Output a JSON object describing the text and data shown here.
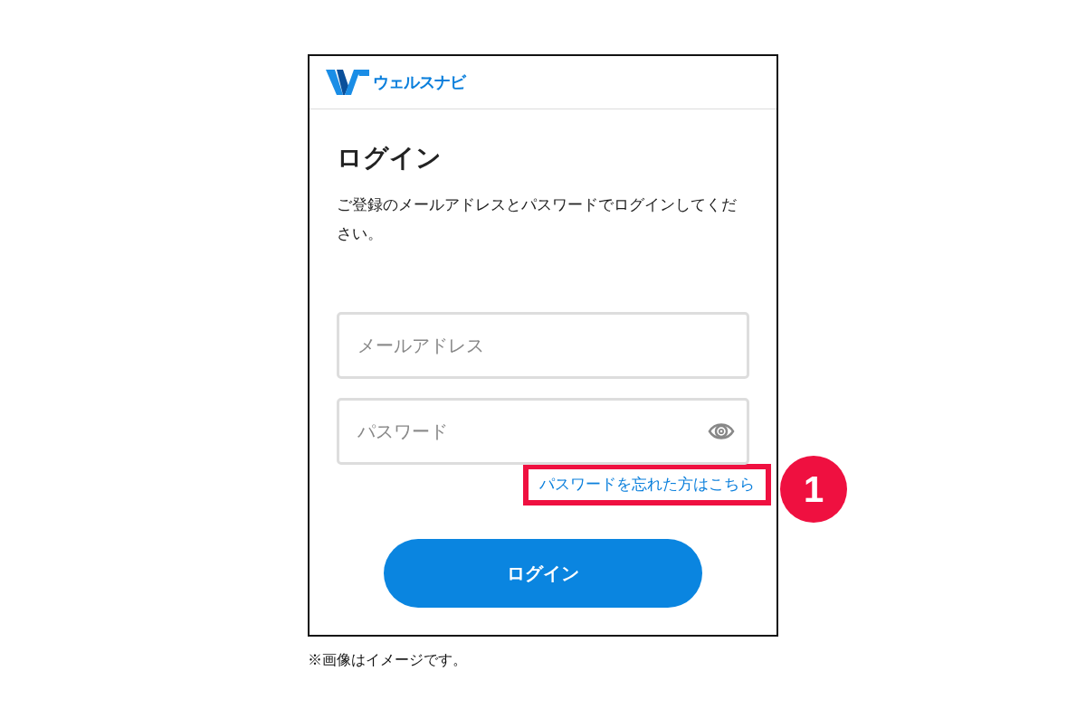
{
  "header": {
    "logo_text": "ウェルスナビ"
  },
  "title": "ログイン",
  "description": "ご登録のメールアドレスとパスワードでログインしてください。",
  "fields": [
    {
      "kind": "text",
      "placeholder": "メールアドレス"
    },
    {
      "kind": "password",
      "placeholder": "パスワード"
    }
  ],
  "forgot_link": {
    "text": "パスワードを忘れた方はこちら",
    "highlighted": true
  },
  "callout": {
    "number": "1"
  },
  "submit": "ログイン",
  "note": "※画像はイメージです。"
}
